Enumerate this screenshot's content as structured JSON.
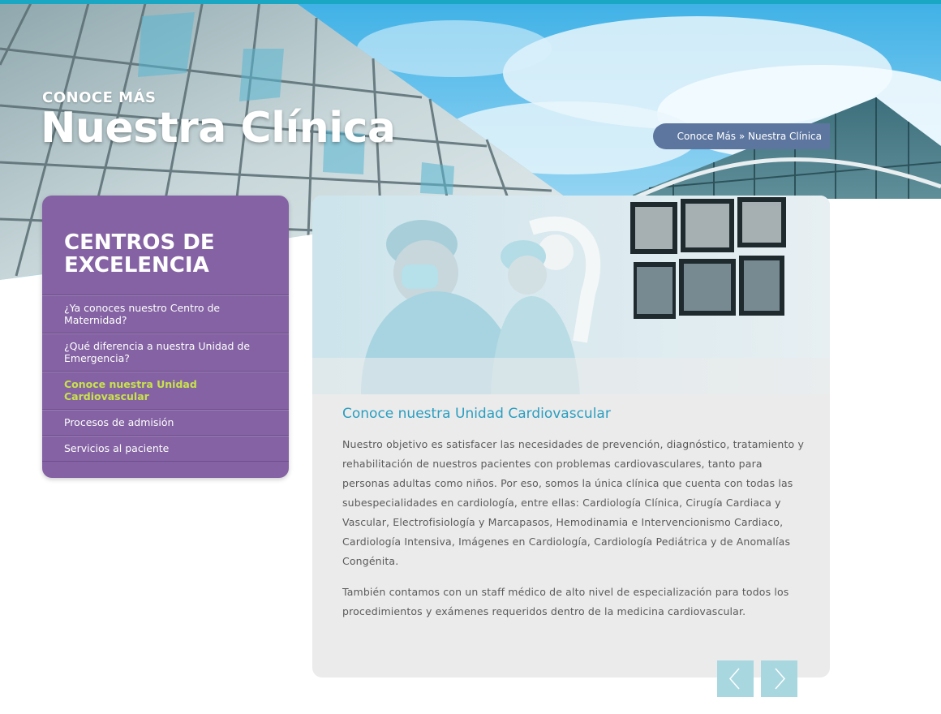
{
  "hero": {
    "kicker": "CONOCE MÁS",
    "title": "Nuestra Clínica"
  },
  "breadcrumb": {
    "parent": "Conoce Más",
    "separator": " » ",
    "current": "Nuestra Clínica"
  },
  "sidebar": {
    "title": "CENTROS DE EXCELENCIA",
    "items": [
      {
        "label": "¿Ya conoces nuestro Centro de Maternidad?",
        "active": false
      },
      {
        "label": "¿Qué diferencia a nuestra Unidad de Emergencia?",
        "active": false
      },
      {
        "label": "Conoce nuestra Unidad Cardiovascular",
        "active": true
      },
      {
        "label": "Procesos de admisión",
        "active": false
      },
      {
        "label": "Servicios al paciente",
        "active": false
      }
    ]
  },
  "article": {
    "title": "Conoce nuestra Unidad Cardiovascular",
    "paragraphs": [
      "Nuestro objetivo es satisfacer las necesidades de prevención, diagnóstico, tratamiento y rehabilitación de nuestros pacientes con problemas cardiovasculares, tanto para personas adultas como niños.  Por eso, somos la única clínica que cuenta con todas las subespecialidades en cardiología, entre ellas: Cardiología Clínica, Cirugía Cardiaca y Vascular, Electrofisiología y Marcapasos, Hemodinamia e Intervencionismo Cardiaco, Cardiología Intensiva, Imágenes en Cardiología, Cardiología Pediátrica y de Anomalías Congénita.",
      "También contamos con un staff médico de alto nivel de especialización para todos los procedimientos y exámenes requeridos dentro de la medicina cardiovascular."
    ]
  },
  "pager": {
    "prev_icon": "chevron-left-icon",
    "next_icon": "chevron-right-icon"
  },
  "colors": {
    "accent_teal": "#19a7c4",
    "sidebar_purple": "#8462a3",
    "active_item": "#c9e24b",
    "breadcrumb_bg": "#5d76a0",
    "article_title": "#2a9ec0",
    "pager_button": "#a9d7e0"
  }
}
